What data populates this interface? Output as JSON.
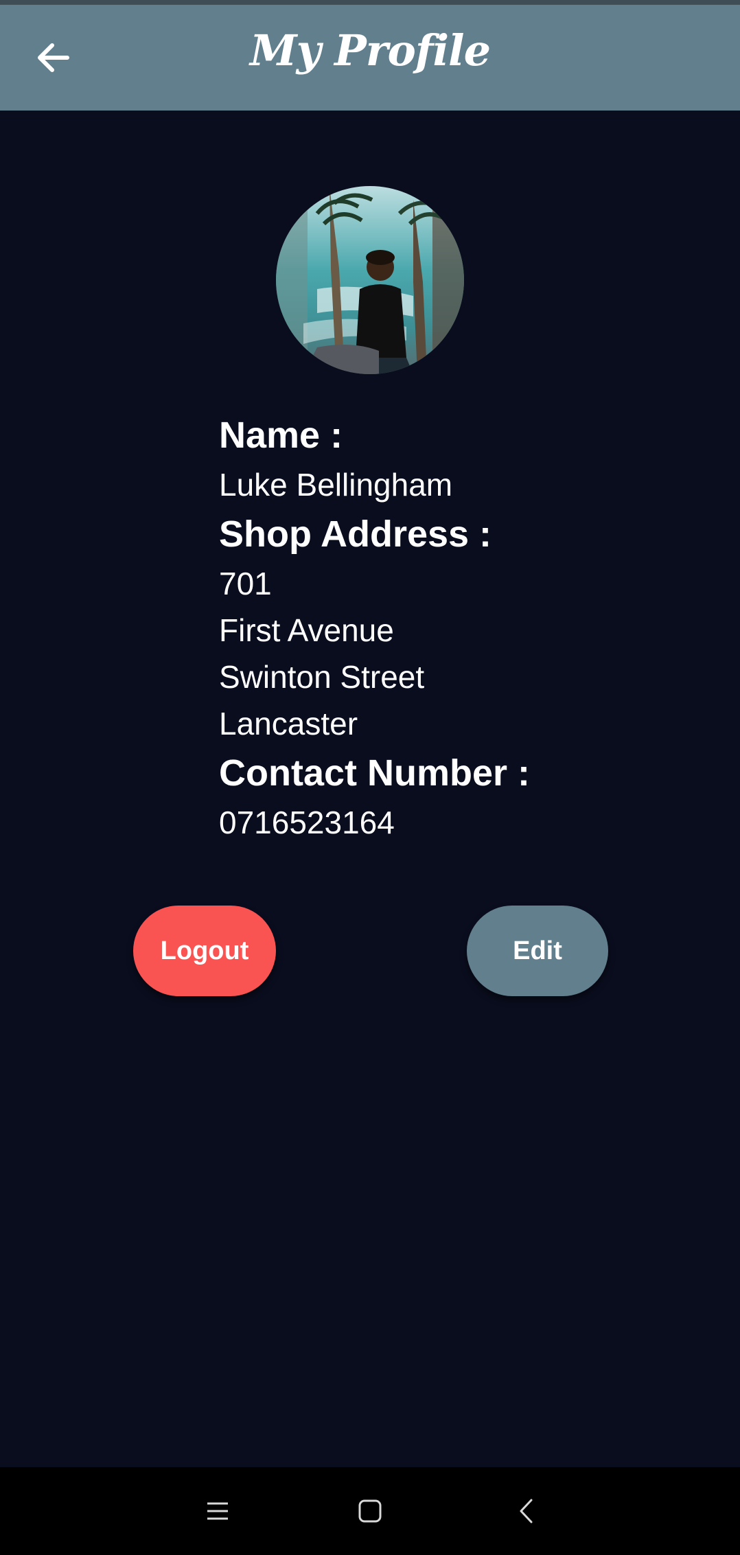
{
  "app_bar": {
    "title": "My Profile",
    "back_icon": "arrow-left-icon"
  },
  "profile": {
    "avatar_alt": "profile-photo",
    "name_label": "Name :",
    "name_value": "Luke Bellingham",
    "address_label": "Shop Address :",
    "address_lines": [
      "701",
      "First Avenue",
      "Swinton Street",
      "Lancaster"
    ],
    "contact_label": "Contact Number :",
    "contact_value": "0716523164"
  },
  "actions": {
    "logout_label": "Logout",
    "edit_label": "Edit"
  },
  "system_nav": {
    "recents_icon": "menu-lines-icon",
    "home_icon": "square-home-icon",
    "back_icon": "chevron-left-icon"
  },
  "colors": {
    "app_bar": "#627f8d",
    "background": "#0a0d1e",
    "logout": "#f95352",
    "edit": "#627f8d"
  }
}
